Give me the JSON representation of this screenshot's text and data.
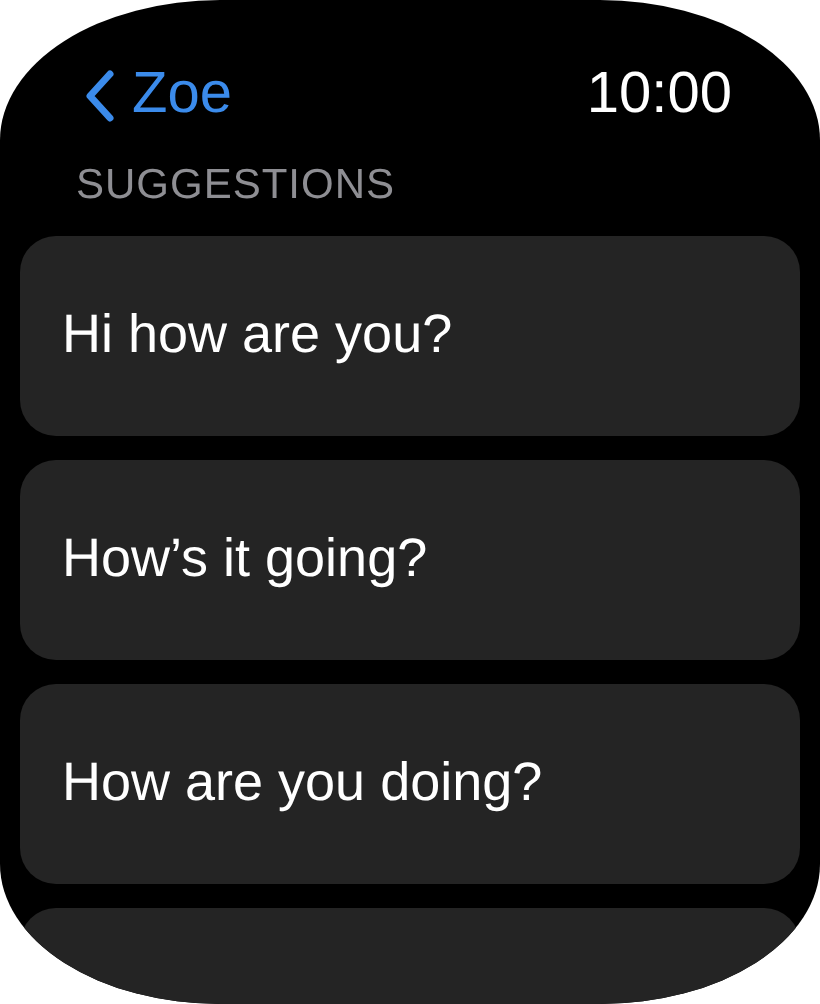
{
  "nav": {
    "back_label": "Zoe",
    "time": "10:00"
  },
  "section_title": "SUGGESTIONS",
  "suggestions": [
    {
      "text": "Hi how are you?"
    },
    {
      "text": "How’s it going?"
    },
    {
      "text": "How are you doing?"
    }
  ]
}
